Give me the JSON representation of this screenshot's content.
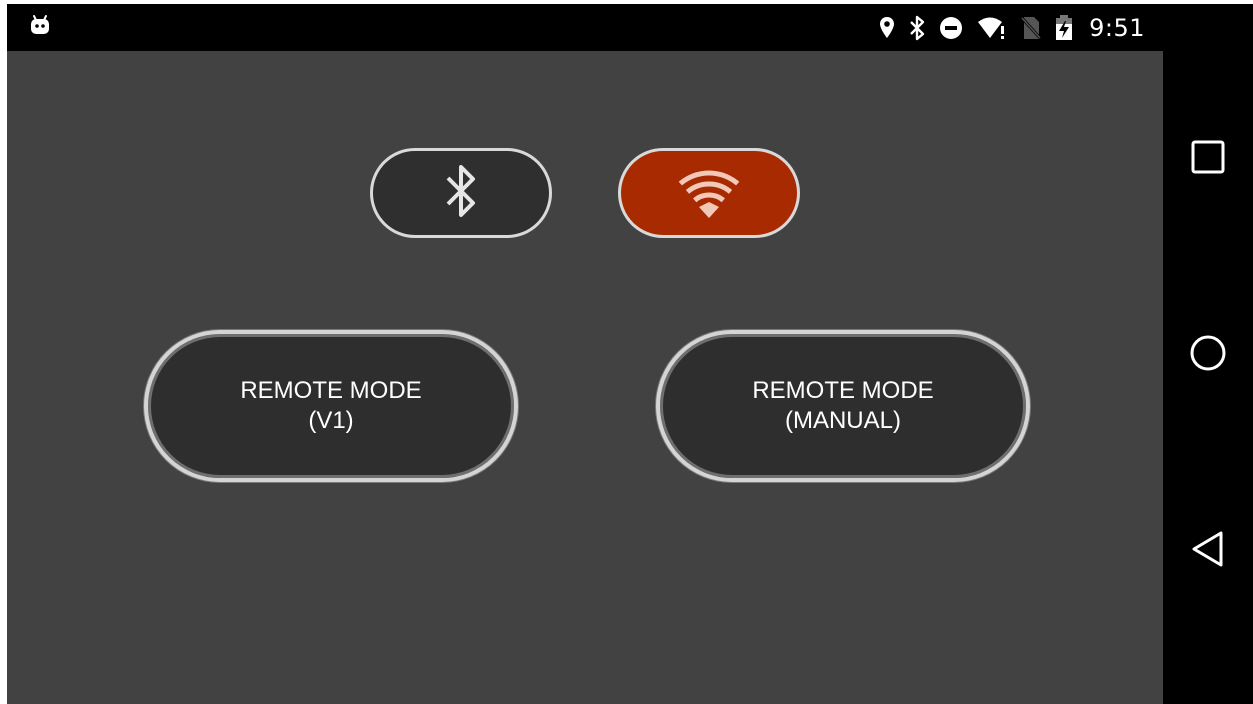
{
  "status_bar": {
    "notification_icon": "android-robot-icon",
    "icons": [
      "location-icon",
      "bluetooth-icon",
      "do-not-disturb-icon",
      "wifi-alert-icon",
      "no-sim-icon",
      "battery-charging-icon"
    ],
    "time": "9:51"
  },
  "connection_toggles": {
    "bluetooth": {
      "icon": "bluetooth-icon",
      "selected": false
    },
    "wifi": {
      "icon": "wifi-icon",
      "selected": true,
      "color": "#a82a00"
    }
  },
  "mode_buttons": {
    "v1": {
      "line1": "REMOTE MODE",
      "line2": "(V1)"
    },
    "manual": {
      "line1": "REMOTE MODE",
      "line2": "(MANUAL)"
    }
  },
  "nav_bar": {
    "recents": "recents-square-icon",
    "home": "home-circle-icon",
    "back": "back-triangle-icon"
  },
  "colors": {
    "background": "#424242",
    "button_fill": "#2e2e2e",
    "accent": "#a82a00"
  }
}
